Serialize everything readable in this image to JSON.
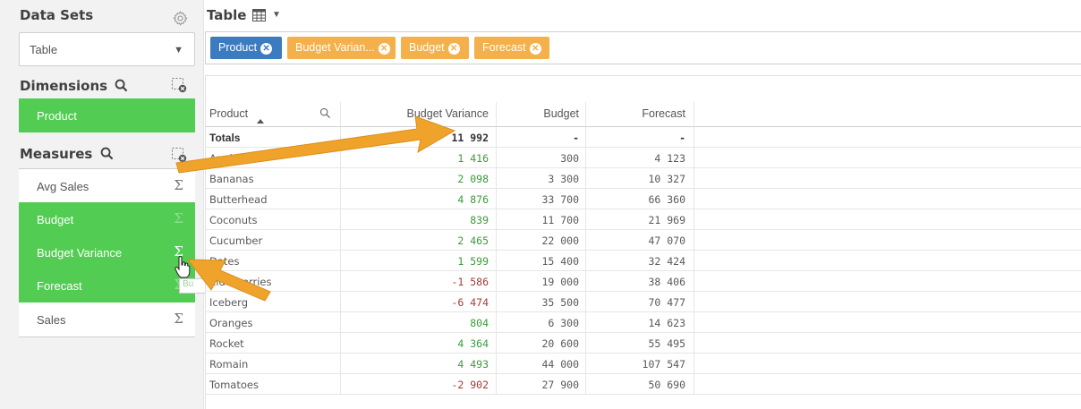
{
  "colors": {
    "accent_green": "#52cc52",
    "chip_blue": "#3b7bbf",
    "chip_orange": "#f4b04a",
    "positive": "#3a9a3a",
    "negative": "#a53a3a",
    "arrow": "#f0a32b"
  },
  "sidebar": {
    "datasets_title": "Data Sets",
    "datasets_selected": "Table",
    "dimensions_title": "Dimensions",
    "measures_title": "Measures",
    "dimensions": [
      {
        "label": "Product",
        "selected": true
      }
    ],
    "measures": [
      {
        "label": "Avg Sales",
        "symbol": "Σ",
        "selected": false
      },
      {
        "label": "Budget",
        "symbol": "Σ",
        "selected": true
      },
      {
        "label": "Budget Variance",
        "symbol": "Σ",
        "selected": true
      },
      {
        "label": "Forecast",
        "symbol": "Σ",
        "selected": true
      },
      {
        "label": "Sales",
        "symbol": "Σ",
        "selected": false
      }
    ],
    "tooltip_text": "Bu"
  },
  "main": {
    "title": "Table",
    "chips": [
      {
        "label": "Product",
        "type": "dimension"
      },
      {
        "label": "Budget Varian...",
        "type": "measure"
      },
      {
        "label": "Budget",
        "type": "measure"
      },
      {
        "label": "Forecast",
        "type": "measure"
      }
    ],
    "table": {
      "columns": [
        "Product",
        "Budget Variance",
        "Budget",
        "Forecast"
      ],
      "totals": [
        "Totals",
        "11 992",
        "-",
        "-"
      ],
      "rows": [
        [
          "Apples",
          "1 416",
          "300",
          "4 123"
        ],
        [
          "Bananas",
          "2 098",
          "3 300",
          "10 327"
        ],
        [
          "Butterhead",
          "4 876",
          "33 700",
          "66 360"
        ],
        [
          "Coconuts",
          "839",
          "11 700",
          "21 969"
        ],
        [
          "Cucumber",
          "2 465",
          "22 000",
          "47 070"
        ],
        [
          "Dates",
          "1 599",
          "15 400",
          "32 424"
        ],
        [
          "Elderberries",
          "-1 586",
          "19 000",
          "38 406"
        ],
        [
          "Iceberg",
          "-6 474",
          "35 500",
          "70 477"
        ],
        [
          "Oranges",
          "804",
          "6 300",
          "14 623"
        ],
        [
          "Rocket",
          "4 364",
          "20 600",
          "55 495"
        ],
        [
          "Romain",
          "4 493",
          "44 000",
          "107 547"
        ],
        [
          "Tomatoes",
          "-2 902",
          "27 900",
          "50 690"
        ]
      ]
    }
  },
  "icons": [
    "gear-icon",
    "search-icon",
    "clear-selection-icon",
    "table-icon",
    "chevron-down-icon",
    "remove-chip-icon",
    "sort-ascending-icon",
    "hand-cursor-icon"
  ]
}
